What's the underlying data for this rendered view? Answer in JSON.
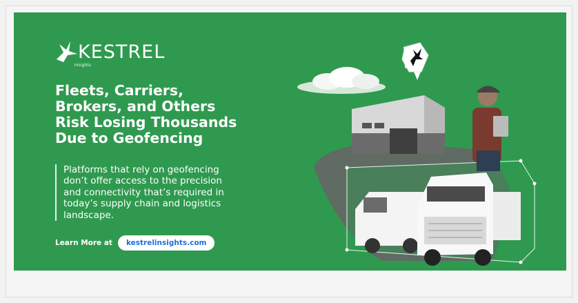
{
  "brand": {
    "name": "KESTREL",
    "subtitle": "insights"
  },
  "headline": {
    "lines": [
      "Fleets, Carriers,",
      "Brokers, and Others",
      "Risk Losing Thousands",
      "Due to Geofencing"
    ]
  },
  "body": {
    "lines": [
      "Platforms that rely on geofencing",
      "don’t offer access to the precision",
      "and connectivity that’s required in",
      "today’s supply chain and logistics",
      "landscape."
    ]
  },
  "cta": {
    "label": "Learn More at",
    "link": "kestrelinsights.com"
  },
  "colors": {
    "banner_green": "#2f9a4f",
    "link_blue": "#1f6fd6"
  },
  "icons": {
    "logo": "kestrel-bird-icon",
    "map_pin": "map-pin-bird-icon"
  }
}
